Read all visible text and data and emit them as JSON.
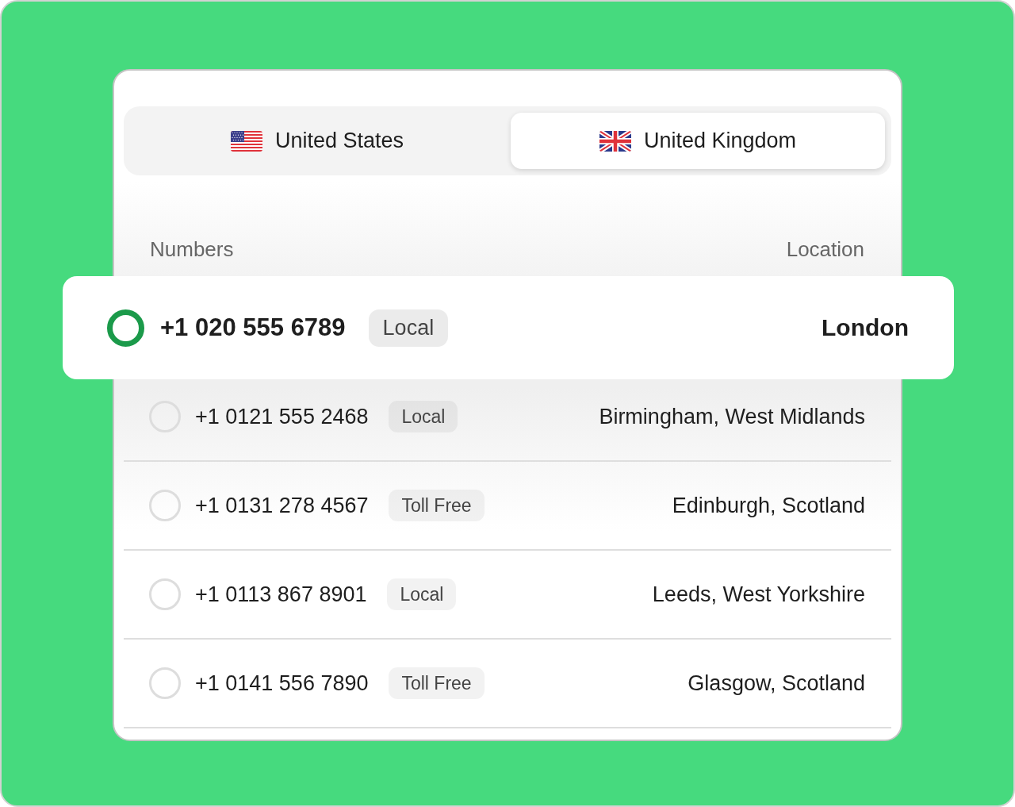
{
  "tabs": [
    {
      "kind": "us",
      "label": "United States",
      "selected": false
    },
    {
      "kind": "uk",
      "label": "United Kingdom",
      "selected": true
    }
  ],
  "table": {
    "columns": [
      "Numbers",
      "Location"
    ],
    "rows": [
      {
        "number": "+1 020 555 6789",
        "type": "Local",
        "location": "London",
        "selected": true
      },
      {
        "number": "+1 0121 555 2468",
        "type": "Local",
        "location": "Birmingham, West Midlands",
        "selected": false
      },
      {
        "number": "+1 0131 278 4567",
        "type": "Toll Free",
        "location": "Edinburgh, Scotland",
        "selected": false
      },
      {
        "number": "+1 0113 867 8901",
        "type": "Local",
        "location": "Leeds, West Yorkshire",
        "selected": false
      },
      {
        "number": "+1 0141 556 7890",
        "type": "Toll Free",
        "location": "Glasgow, Scotland",
        "selected": false
      }
    ]
  }
}
